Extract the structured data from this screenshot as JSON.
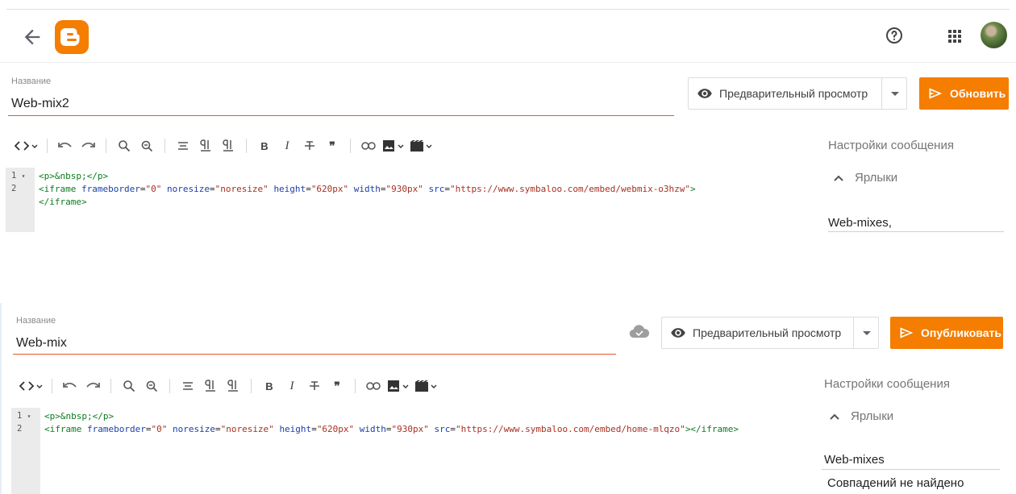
{
  "topbar": {
    "back_icon": "arrow-left-icon",
    "logo_icon": "blogger-logo-icon",
    "help_icon": "help-circle-icon",
    "apps_icon": "apps-grid-icon",
    "brand_color": "#f57d00"
  },
  "editor1": {
    "title_label": "Название",
    "title_value": "Web-mix2",
    "preview_label": "Предварительный просмотр",
    "primary_label": "Обновить",
    "code_line1": "<p>&nbsp;</p>",
    "code_line2_tag_open": "<iframe",
    "code_line2_attr1": "frameborder",
    "code_line2_val1": "\"0\"",
    "code_line2_attr2": "noresize",
    "code_line2_val2": "\"noresize\"",
    "code_line2_attr3": "height",
    "code_line2_val3": "\"620px\"",
    "code_line2_attr4": "width",
    "code_line2_val4": "\"930px\"",
    "code_line2_attr5": "src",
    "code_line2_val5": "\"https://www.symbaloo.com/embed/webmix-o3hzw\"",
    "code_line2_close": ">",
    "code_line3": "</iframe>",
    "line_numbers": [
      "1",
      "2"
    ],
    "settings_title": "Настройки сообщения",
    "labels_title": "Ярлыки",
    "labels_value": "Web-mixes,"
  },
  "editor2": {
    "title_label": "Название",
    "title_value": "Web-mix",
    "preview_label": "Предварительный просмотр",
    "primary_label": "Опубликовать",
    "code_line1": "<p>&nbsp;</p>",
    "code_line2_tag_open": "<iframe",
    "code_line2_attr1": "frameborder",
    "code_line2_val1": "\"0\"",
    "code_line2_attr2": "noresize",
    "code_line2_val2": "\"noresize\"",
    "code_line2_attr3": "height",
    "code_line2_val3": "\"620px\"",
    "code_line2_attr4": "width",
    "code_line2_val4": "\"930px\"",
    "code_line2_attr5": "src",
    "code_line2_val5": "\"https://www.symbaloo.com/embed/home-mlqzo\"",
    "code_line2_close": "></iframe>",
    "line_numbers": [
      "1",
      "2"
    ],
    "settings_title": "Настройки сообщения",
    "labels_title": "Ярлыки",
    "labels_value": "Web-mixes",
    "no_match": "Совпадений не найдено",
    "saved_icon": "cloud-saved-icon"
  },
  "toolbar_icons": [
    "code-view-icon",
    "undo-icon",
    "redo-icon",
    "search-icon",
    "replace-icon",
    "align-icon",
    "paragraph-ltr-icon",
    "paragraph-rtl-icon",
    "bold-icon",
    "italic-icon",
    "strikethrough-icon",
    "quote-icon",
    "link-icon",
    "image-icon",
    "video-icon"
  ],
  "toolbar_labels": {
    "bold": "B",
    "italic": "I",
    "quote": "❞"
  }
}
